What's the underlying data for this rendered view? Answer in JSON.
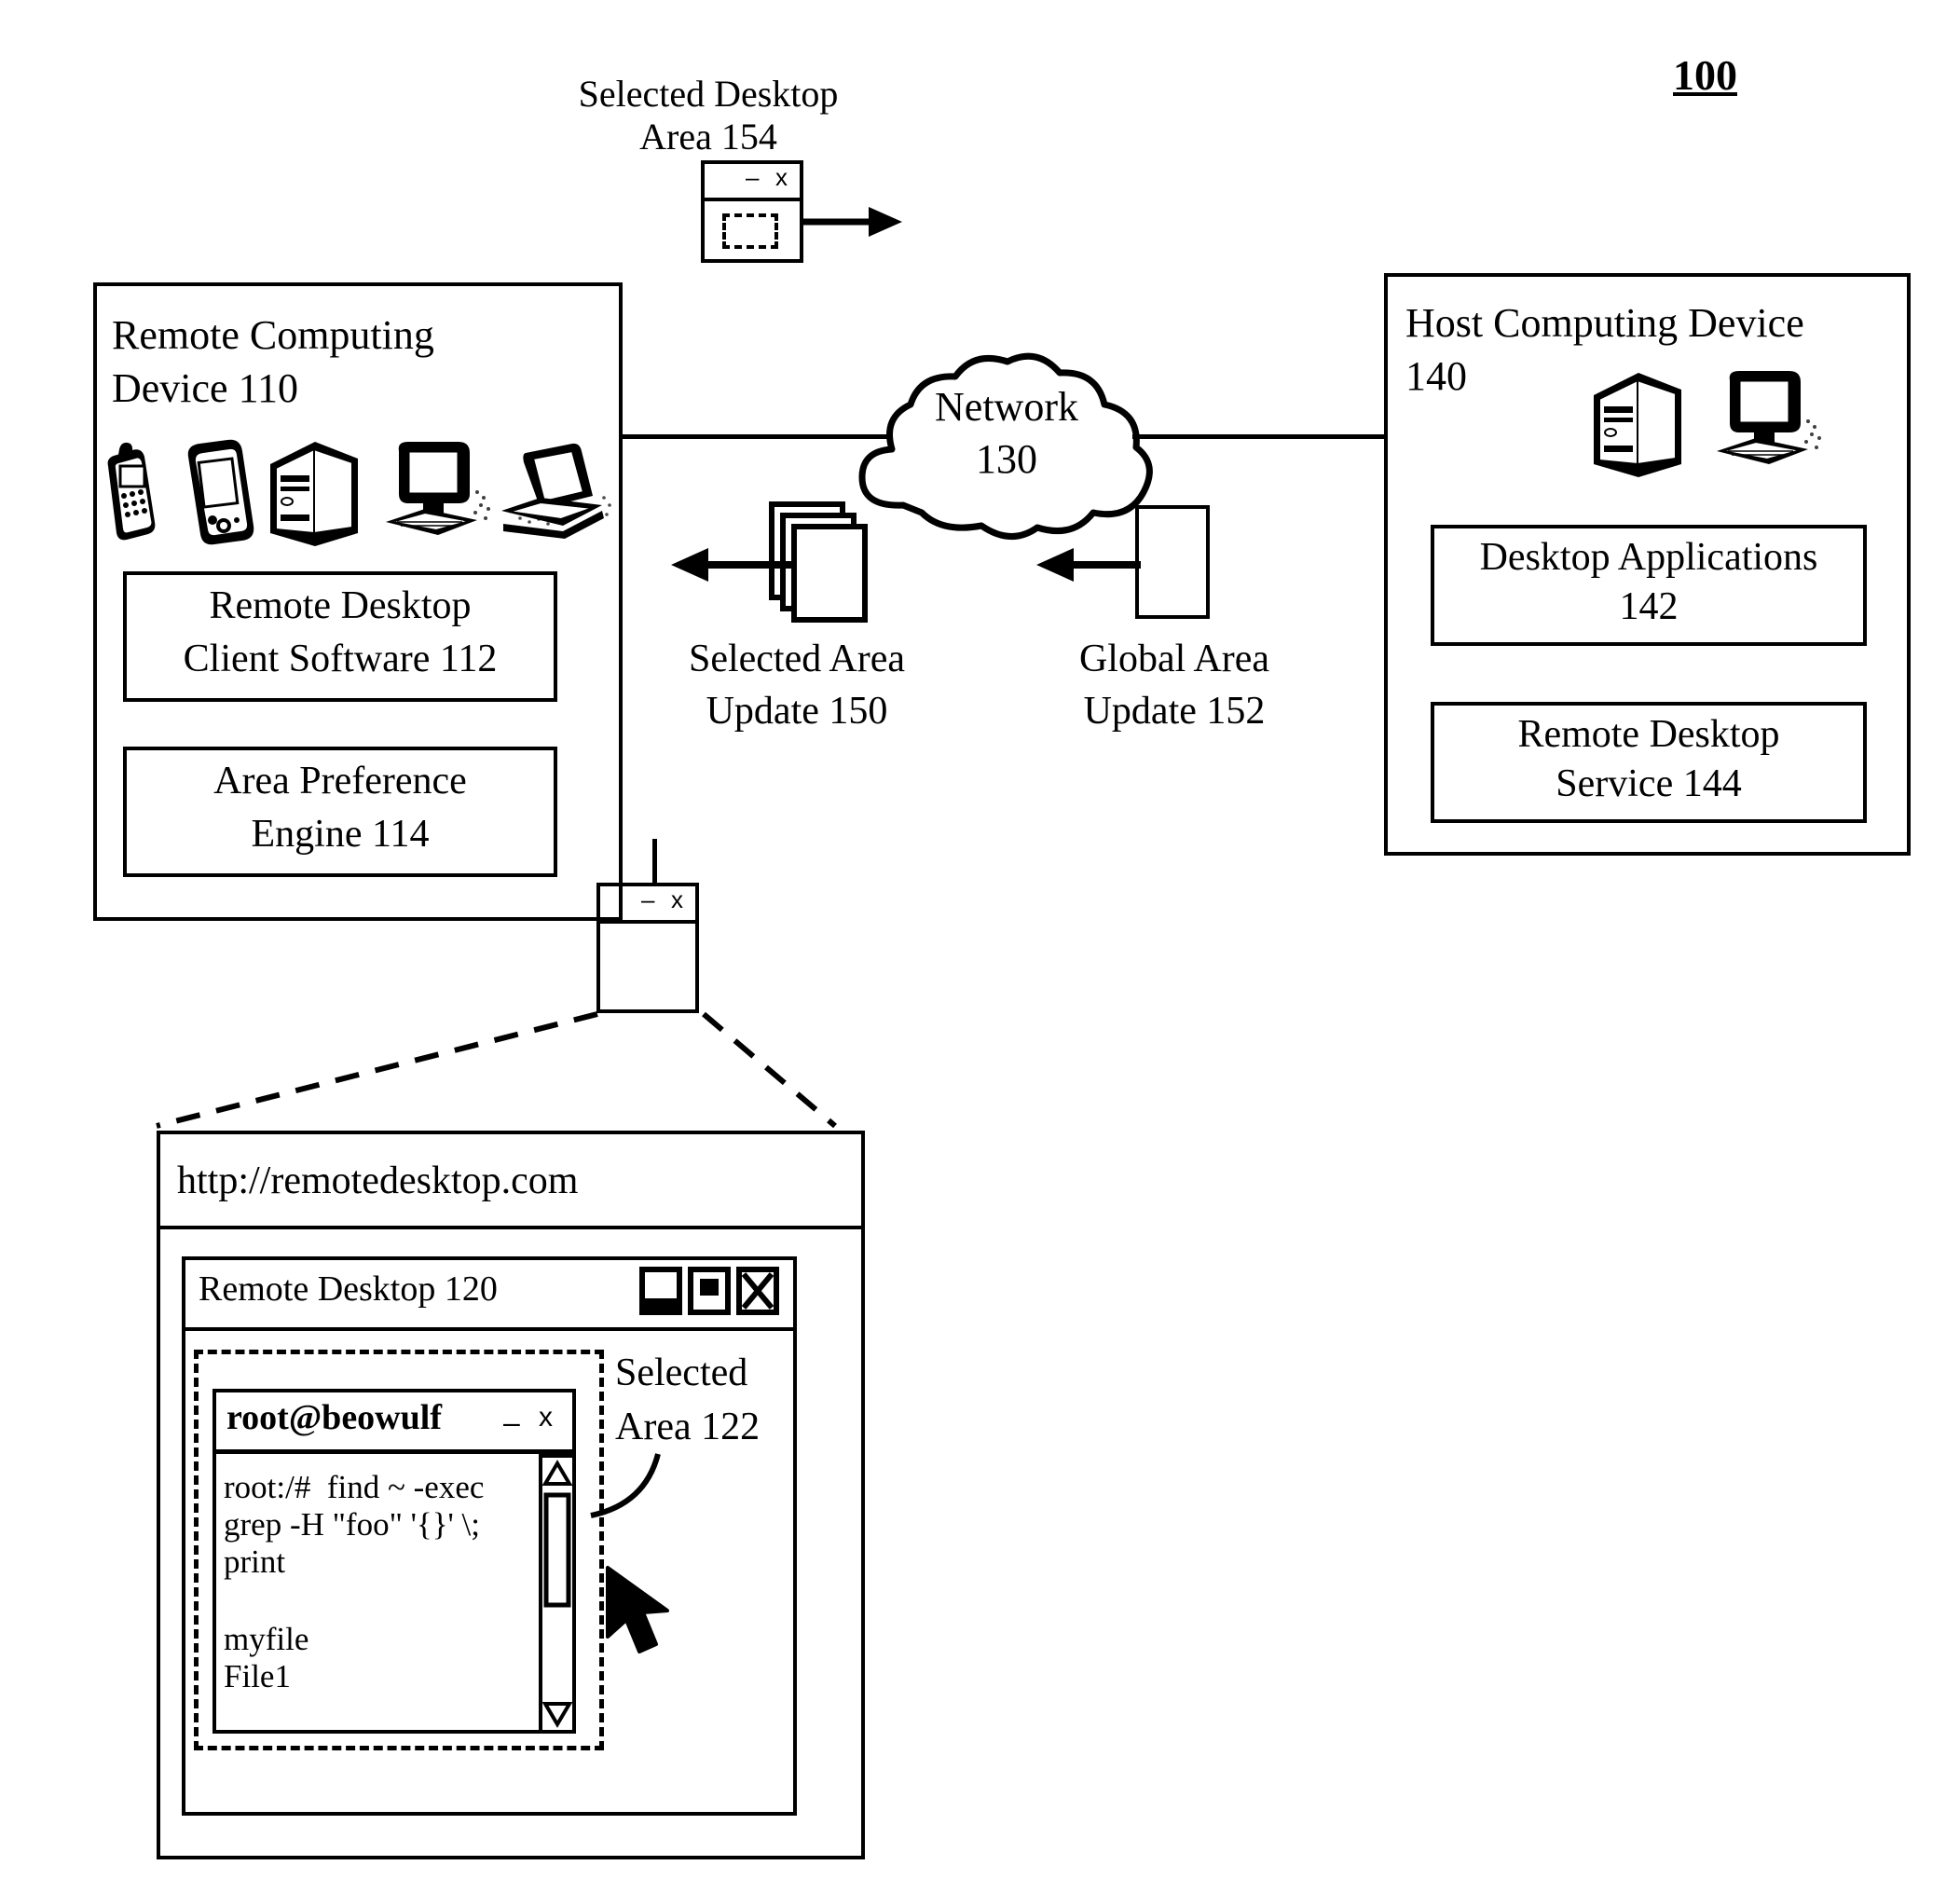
{
  "figure": {
    "number": "100"
  },
  "remote_device": {
    "title_line1": "Remote Computing",
    "title_line2": "Device 110",
    "icons": [
      "mobile-phone-icon",
      "pda-icon",
      "tower-pc-icon",
      "desktop-workstation-icon",
      "laptop-icon"
    ],
    "modules": [
      {
        "line1": "Remote Desktop",
        "line2": "Client Software 112"
      },
      {
        "line1": "Area Preference",
        "line2": "Engine 114"
      }
    ]
  },
  "selected_desktop_area": {
    "label_line1": "Selected Desktop",
    "label_line2": "Area 154",
    "window_controls": {
      "minimize": "–",
      "close": "x"
    }
  },
  "network": {
    "line1": "Network",
    "line2": "130"
  },
  "selected_area_update": {
    "line1": "Selected Area",
    "line2": "Update 150"
  },
  "global_area_update": {
    "line1": "Global Area",
    "line2": "Update 152"
  },
  "host_device": {
    "title_line1": "Host Computing Device",
    "title_line2": "140",
    "icons": [
      "tower-pc-icon",
      "desktop-workstation-icon"
    ],
    "modules": [
      {
        "line1": "Desktop Applications",
        "line2": "142"
      },
      {
        "line1": "Remote Desktop",
        "line2": "Service 144"
      }
    ]
  },
  "magnifier_thumb": {
    "minimize": "–",
    "close": "x"
  },
  "browser": {
    "url": "http://remotedesktop.com",
    "inner_window": {
      "title": "Remote Desktop 120",
      "controls": [
        "minimize-button",
        "maximize-button",
        "close-button"
      ],
      "close_glyph": "X"
    },
    "selected_area_label": {
      "line1": "Selected",
      "line2": "Area 122"
    },
    "terminal": {
      "title": "root@beowulf",
      "minimize": "–",
      "close": "x",
      "lines": [
        "root:/#  find ~ -exec",
        "grep -H \"foo\" '{}' \\;",
        "print",
        "",
        "myfile",
        "File1"
      ],
      "scrollbar": {
        "up_arrow": "△",
        "down_arrow": "▽"
      }
    },
    "cursor": "mouse-pointer-icon"
  },
  "colors": {
    "ink": "#000000",
    "paper": "#ffffff"
  }
}
